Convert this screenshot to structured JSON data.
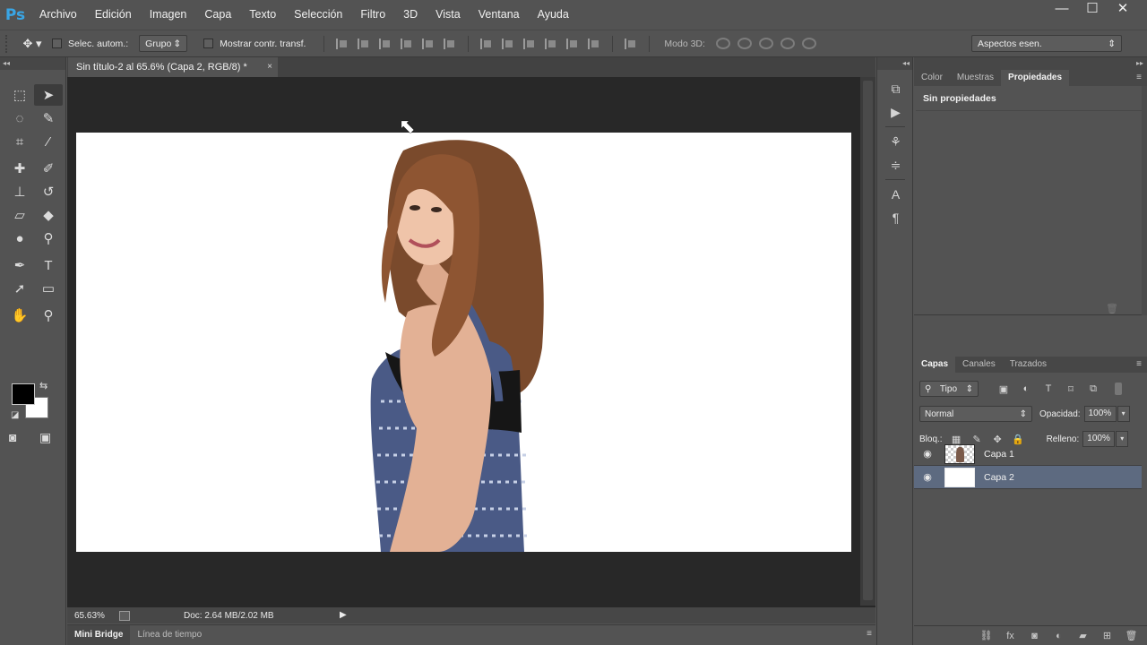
{
  "app": {
    "logo": "Ps"
  },
  "menu": [
    "Archivo",
    "Edición",
    "Imagen",
    "Capa",
    "Texto",
    "Selección",
    "Filtro",
    "3D",
    "Vista",
    "Ventana",
    "Ayuda"
  ],
  "window_controls": {
    "minimize": "—",
    "maximize": "☐",
    "close": "✕"
  },
  "options": {
    "auto_select_label": "Selec. autom.:",
    "auto_select_value": "Grupo",
    "show_transform_label": "Mostrar contr. transf.",
    "mode3d_label": "Modo 3D:",
    "workspace_value": "Aspectos esen."
  },
  "document": {
    "tab_title": "Sin título-2 al 65.6% (Capa 2, RGB/8) *",
    "close_glyph": "×",
    "zoom": "65.63%",
    "doc_size": "Doc: 2.64 MB/2.02 MB",
    "status_arrow": "▶"
  },
  "bottom_tabs": {
    "mini_bridge": "Mini Bridge",
    "timeline": "Línea de tiempo",
    "menu_glyph": "≡"
  },
  "panels": {
    "collapse_glyph": "◂◂",
    "expand_glyph": "▸▸",
    "properties_tabs": [
      "Color",
      "Muestras",
      "Propiedades"
    ],
    "properties_empty": "Sin propiedades",
    "layers_tabs": [
      "Capas",
      "Canales",
      "Trazados"
    ],
    "menu_glyph": "≡"
  },
  "layers": {
    "kind_filter": "Tipo",
    "blend_mode": "Normal",
    "opacity_label": "Opacidad:",
    "opacity_value": "100%",
    "lock_label": "Bloq.:",
    "fill_label": "Relleno:",
    "fill_value": "100%",
    "items": [
      {
        "name": "Capa 1",
        "selected": false,
        "visible": true
      },
      {
        "name": "Capa 2",
        "selected": true,
        "visible": true
      }
    ]
  },
  "colors": {
    "foreground": "#000000",
    "background": "#ffffff",
    "accent_selected_layer": "#5d6a80"
  }
}
